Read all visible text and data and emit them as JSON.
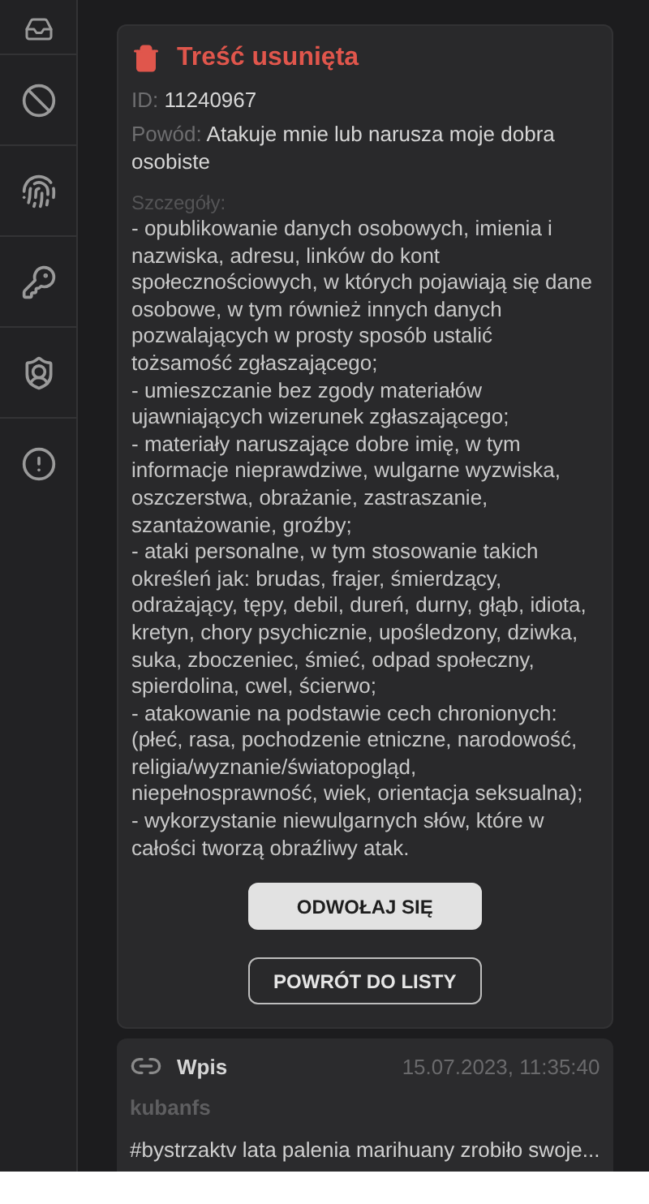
{
  "removed_card": {
    "title": "Treść usunięta",
    "id_label": "ID:",
    "id_value": "11240967",
    "reason_label": "Powód:",
    "reason_value": "Atakuje mnie lub narusza moje dobra osobiste",
    "details_label": "Szczegóły:",
    "details": [
      "- opublikowanie danych osobowych, imienia i nazwiska, adresu, linków do kont społecznościowych, w których pojawiają się dane osobowe, w tym również innych danych pozwalających w prosty sposób ustalić tożsamość zgłaszającego;",
      "- umieszczanie bez zgody materiałów ujawniających wizerunek zgłaszającego;",
      "- materiały naruszające dobre imię, w tym informacje nieprawdziwe, wulgarne wyzwiska, oszczerstwa, obrażanie, zastraszanie, szantażowanie, groźby;",
      "- ataki personalne, w tym stosowanie takich określeń jak: brudas, frajer, śmierdzący, odrażający, tępy, debil, dureń, durny, głąb, idiota, kretyn, chory psychicznie, upośledzony, dziwka, suka, zboczeniec, śmieć, odpad społeczny, spierdolina, cwel, ścierwo;",
      "- atakowanie na podstawie cech chronionych: (płeć, rasa, pochodzenie etniczne, narodowość, religia/wyznanie/światopogląd, niepełnosprawność, wiek, orientacja seksualna);",
      "- wykorzystanie niewulgarnych słów, które w całości tworzą obraźliwy atak."
    ],
    "buttons": [
      {
        "label": "ODWOŁAJ SIĘ",
        "kind": "filled"
      },
      {
        "label": "POWRÓT DO LISTY",
        "kind": "outlined"
      }
    ]
  },
  "entry_card": {
    "type": "Wpis",
    "date": "15.07.2023, 11:35:40",
    "author": "kubanfs",
    "excerpt": "#bystrzaktv lata palenia marihuany zrobiło swoje..."
  }
}
